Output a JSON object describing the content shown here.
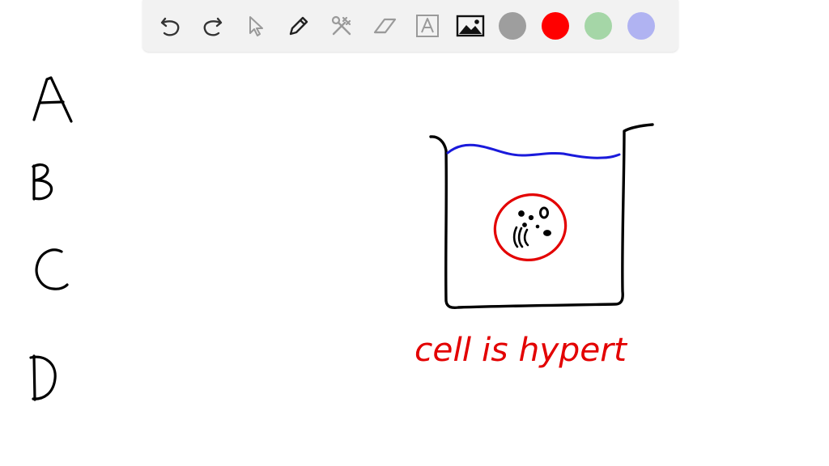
{
  "toolbar": {
    "tools": [
      {
        "icon": "undo-icon"
      },
      {
        "icon": "redo-icon"
      },
      {
        "icon": "pointer-icon"
      },
      {
        "icon": "pen-icon"
      },
      {
        "icon": "tools-icon"
      },
      {
        "icon": "eraser-icon"
      },
      {
        "icon": "text-box-icon"
      },
      {
        "icon": "image-icon"
      }
    ],
    "colors": [
      "#9e9e9e",
      "#ff0000",
      "#a5d6a7",
      "#b0b3f2"
    ]
  },
  "whiteboard": {
    "letters": [
      "A",
      "B",
      "C",
      "D"
    ],
    "caption": "cell is hypert",
    "ink_colors": {
      "black": "#000000",
      "blue": "#1a1adb",
      "red": "#e30000"
    }
  }
}
